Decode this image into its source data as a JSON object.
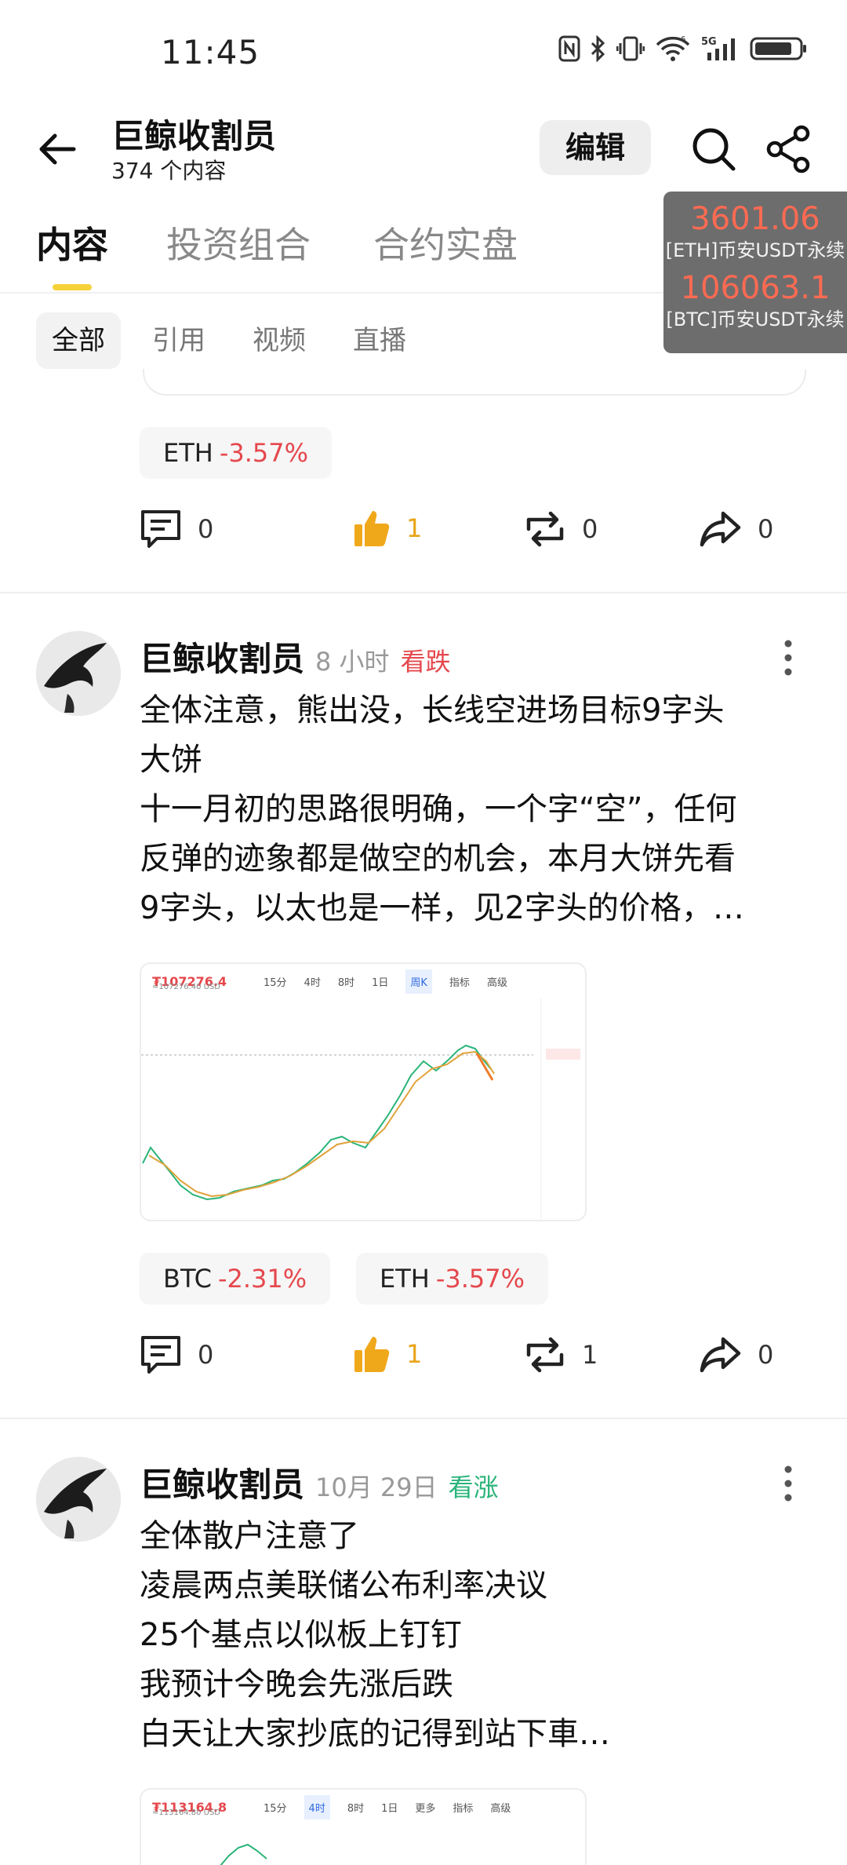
{
  "status_bar": {
    "time": "11:45",
    "network": "5G"
  },
  "header": {
    "title": "巨鲸收割员",
    "subtitle": "374 个内容",
    "edit_label": "编辑"
  },
  "tabs": [
    {
      "label": "内容",
      "active": true
    },
    {
      "label": "投资组合",
      "active": false
    },
    {
      "label": "合约实盘",
      "active": false
    }
  ],
  "ticker": {
    "eth_price": "3601.06",
    "eth_label": "[ETH]币安USDT永续",
    "btc_price": "106063.1",
    "btc_label": "[BTC]币安USDT永续"
  },
  "filters": [
    {
      "label": "全部",
      "active": true
    },
    {
      "label": "引用",
      "active": false
    },
    {
      "label": "视频",
      "active": false
    },
    {
      "label": "直播",
      "active": false
    }
  ],
  "prev_post": {
    "coins": [
      {
        "symbol": "ETH",
        "change": "-3.57%"
      }
    ],
    "comments": "0",
    "likes": "1",
    "reposts": "0",
    "shares": "0"
  },
  "post1": {
    "author": "巨鲸收割员",
    "time": "8 小时",
    "sentiment": "看跌",
    "lines": [
      "全体注意，熊出没，长线空进场目标9字头",
      "大饼",
      "十一月初的思路很明确，一个字“空”，任何",
      "反弹的迹象都是做空的机会，本月大饼先看",
      "9字头，以太也是一样，见2字头的价格，…"
    ],
    "chart": {
      "price": "₮107276.4",
      "sub": "≈107276.40 USD",
      "timeframes": [
        "15分",
        "4时",
        "8时",
        "1日",
        "周K",
        "指标",
        "高级"
      ],
      "selected": "周K"
    },
    "coins": [
      {
        "symbol": "BTC",
        "change": "-2.31%"
      },
      {
        "symbol": "ETH",
        "change": "-3.57%"
      }
    ],
    "comments": "0",
    "likes": "1",
    "reposts": "1",
    "shares": "0"
  },
  "post2": {
    "author": "巨鲸收割员",
    "time": "10月 29日",
    "sentiment": "看涨",
    "lines": [
      "全体散户注意了",
      "凌晨两点美联储公布利率决议",
      "25个基点以似板上钉钉",
      "我预计今晚会先涨后跌",
      "白天让大家抄底的记得到站下車…"
    ],
    "chart": {
      "price": "₮113164.8",
      "sub": "≈113164.80 USD",
      "timeframes": [
        "15分",
        "4时",
        "8时",
        "1日",
        "更多",
        "指标",
        "高级"
      ],
      "selected": "4时"
    }
  },
  "colors": {
    "accent": "#f6d23a",
    "down": "#e5484d",
    "up": "#2bb47a",
    "like": "#e8a41a"
  }
}
